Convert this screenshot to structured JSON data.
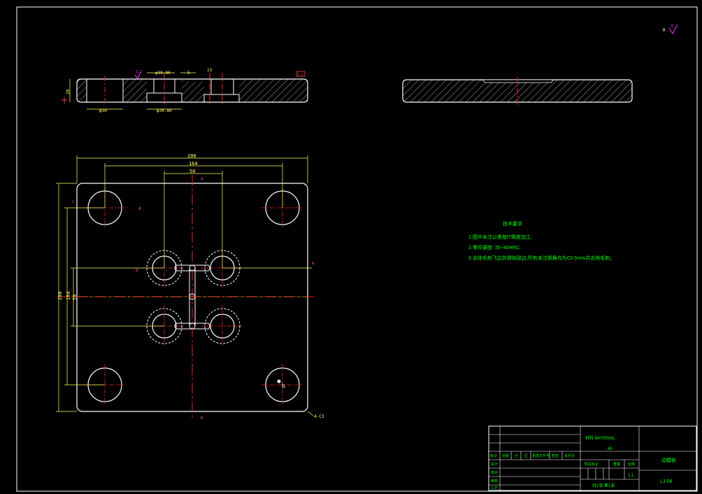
{
  "colors": {
    "background": "#000000",
    "outline": "#ffffff",
    "centerline": "#ff2020",
    "dimension": "#ffff66",
    "hatch": "#cfcfcf",
    "accent": "#ff33ff",
    "text_green": "#00ff00",
    "red_text": "#ff3b3b",
    "marker": "#ff44aa"
  },
  "top_view_dims": {
    "overall_width": "200",
    "outer_holes": "164",
    "inner_holes": "50",
    "overall_height": "200",
    "height_164": "164",
    "height_50": "50",
    "chamfer_note": "4-C3"
  },
  "section_view_dims": {
    "hole_dia_left": "φ30",
    "hole_dia_center": "φ30.80",
    "hole_dia_top": "φ30.80",
    "slot": "5",
    "thickness": "20",
    "depth": "13"
  },
  "surface_finish": {
    "main": "3.2",
    "section": "3.2",
    "corner": "3.2"
  },
  "markers": {
    "a": "a",
    "b": "b",
    "c": "c",
    "d": "d",
    "e": "e",
    "r": "R"
  },
  "tech_requirements": {
    "title": "技术要求",
    "items": [
      "1.图中未注公差按IT精度加工;",
      "2.零件硬度: 35~40HRC;",
      "3.去除毛刺飞边并倒钝锐边,所有未注倒角均为C0.5mm并去除毛刺。"
    ]
  },
  "title_block": {
    "material_label": "材料 MATERIAL",
    "material_value": "45",
    "headers": [
      "标记",
      "处数",
      "分",
      "区",
      "更改文件号",
      "签名",
      "年月日"
    ],
    "rows": [
      "设计",
      "校对",
      "审核",
      "工艺"
    ],
    "right_labels": [
      "阶段标记",
      "重量",
      "比例"
    ],
    "scale": "1:1",
    "sheet": "共1张 第1张",
    "part_name": "动模板",
    "drawing_no": "LJ-08"
  }
}
